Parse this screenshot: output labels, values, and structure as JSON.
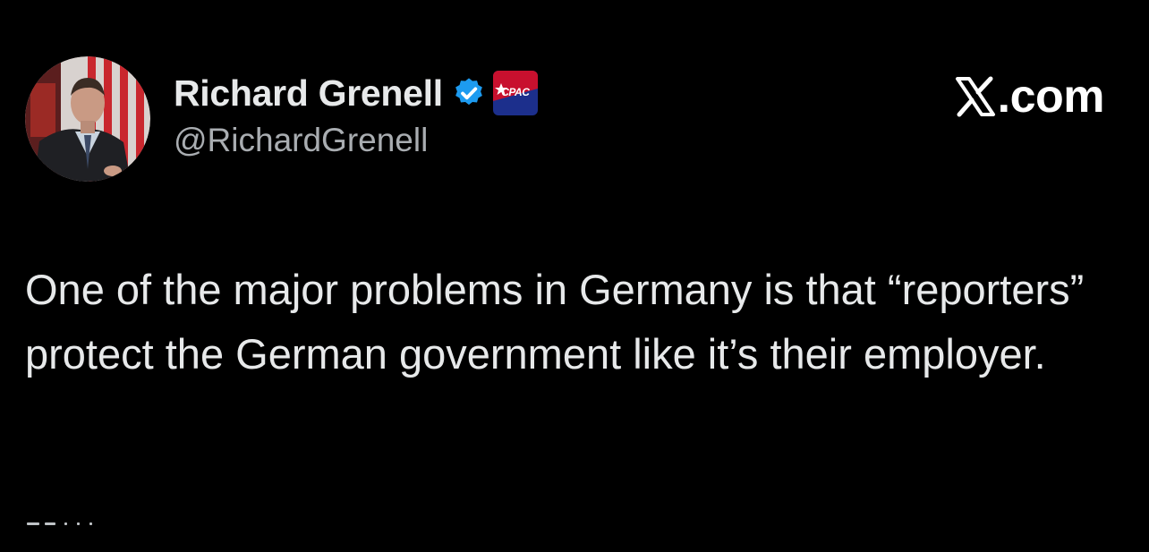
{
  "tweet": {
    "author": {
      "display_name": "Richard Grenell",
      "handle": "@RichardGrenell",
      "verified": true,
      "verified_icon": "verified-check-icon",
      "affiliate_badge_text": "CPAC",
      "avatar": "profile-photo"
    },
    "site": {
      "label": ".com",
      "logo_icon": "x-logo-icon"
    },
    "text": "One of the major problems in Germany is that “reporters” protect the German government like it’s their employer."
  },
  "colors": {
    "background": "#000000",
    "text_primary": "#e7e9ea",
    "text_secondary": "#a9adb1",
    "verified_blue": "#1d9bf0",
    "badge_red": "#c8102e",
    "badge_blue": "#1c2f8c"
  }
}
